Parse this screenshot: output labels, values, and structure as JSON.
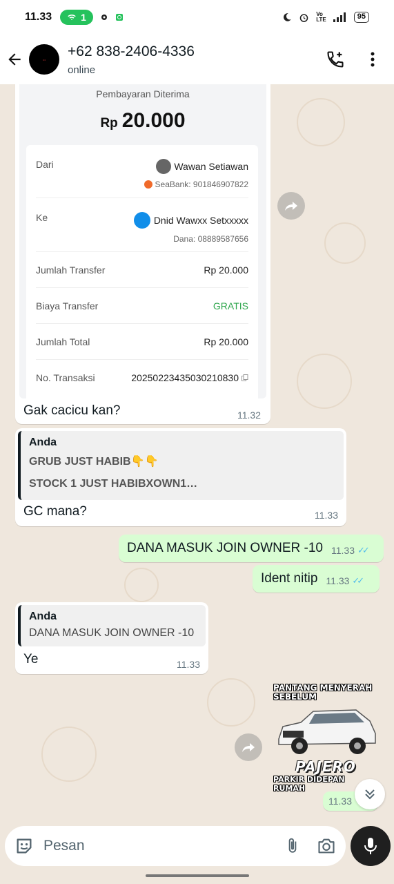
{
  "status_bar": {
    "time": "11.33",
    "hotspot_count": "1",
    "battery": "95"
  },
  "header": {
    "contact_name": "+62 838-2406-4336",
    "status": "online"
  },
  "receipt": {
    "title": "Pembayaran Diterima",
    "currency": "Rp",
    "amount": "20.000",
    "rows": {
      "from_label": "Dari",
      "from_name": "Wawan Setiawan",
      "from_account": "SeaBank: 901846907822",
      "to_label": "Ke",
      "to_name": "Dnid Wawxx Setxxxxx",
      "to_account": "Dana: 08889587656",
      "transfer_label": "Jumlah Transfer",
      "transfer_value": "Rp 20.000",
      "fee_label": "Biaya Transfer",
      "fee_value": "GRATIS",
      "total_label": "Jumlah Total",
      "total_value": "Rp 20.000",
      "txn_label": "No. Transaksi",
      "txn_value": "20250223435030210830"
    }
  },
  "messages": {
    "m1": {
      "text": "Gak cacicu kan?",
      "time": "11.32"
    },
    "m2": {
      "quote_author": "Anda",
      "quote_line1": "GRUB JUST HABIB👇👇",
      "quote_line2": "STOCK 1 JUST HABIBXOWN1…",
      "text": "GC mana?",
      "time": "11.33"
    },
    "m3": {
      "text": "DANA MASUK JOIN OWNER -10",
      "time": "11.33"
    },
    "m4": {
      "text": "Ident nitip",
      "time": "11.33"
    },
    "m5": {
      "quote_author": "Anda",
      "quote_text": "DANA MASUK JOIN OWNER -10",
      "text": "Ye",
      "time": "11.33"
    },
    "sticker": {
      "top_text": "PANTANG MENYERAH SEBELUM",
      "brand": "PAJERO",
      "bottom_text": "PARKIR DIDEPAN RUMAH",
      "time": "11.33"
    }
  },
  "composer": {
    "placeholder": "Pesan"
  },
  "colors": {
    "chat_bg": "#efe7dd",
    "outgoing_bubble": "#d9fdd3",
    "read_ticks": "#53bdeb",
    "gratis_green": "#2fa64d"
  },
  "icons": [
    "back-arrow-icon",
    "add-call-icon",
    "more-vert-icon",
    "forward-icon",
    "sticker-icon",
    "attach-icon",
    "camera-icon",
    "mic-icon",
    "double-chevron-down-icon"
  ]
}
